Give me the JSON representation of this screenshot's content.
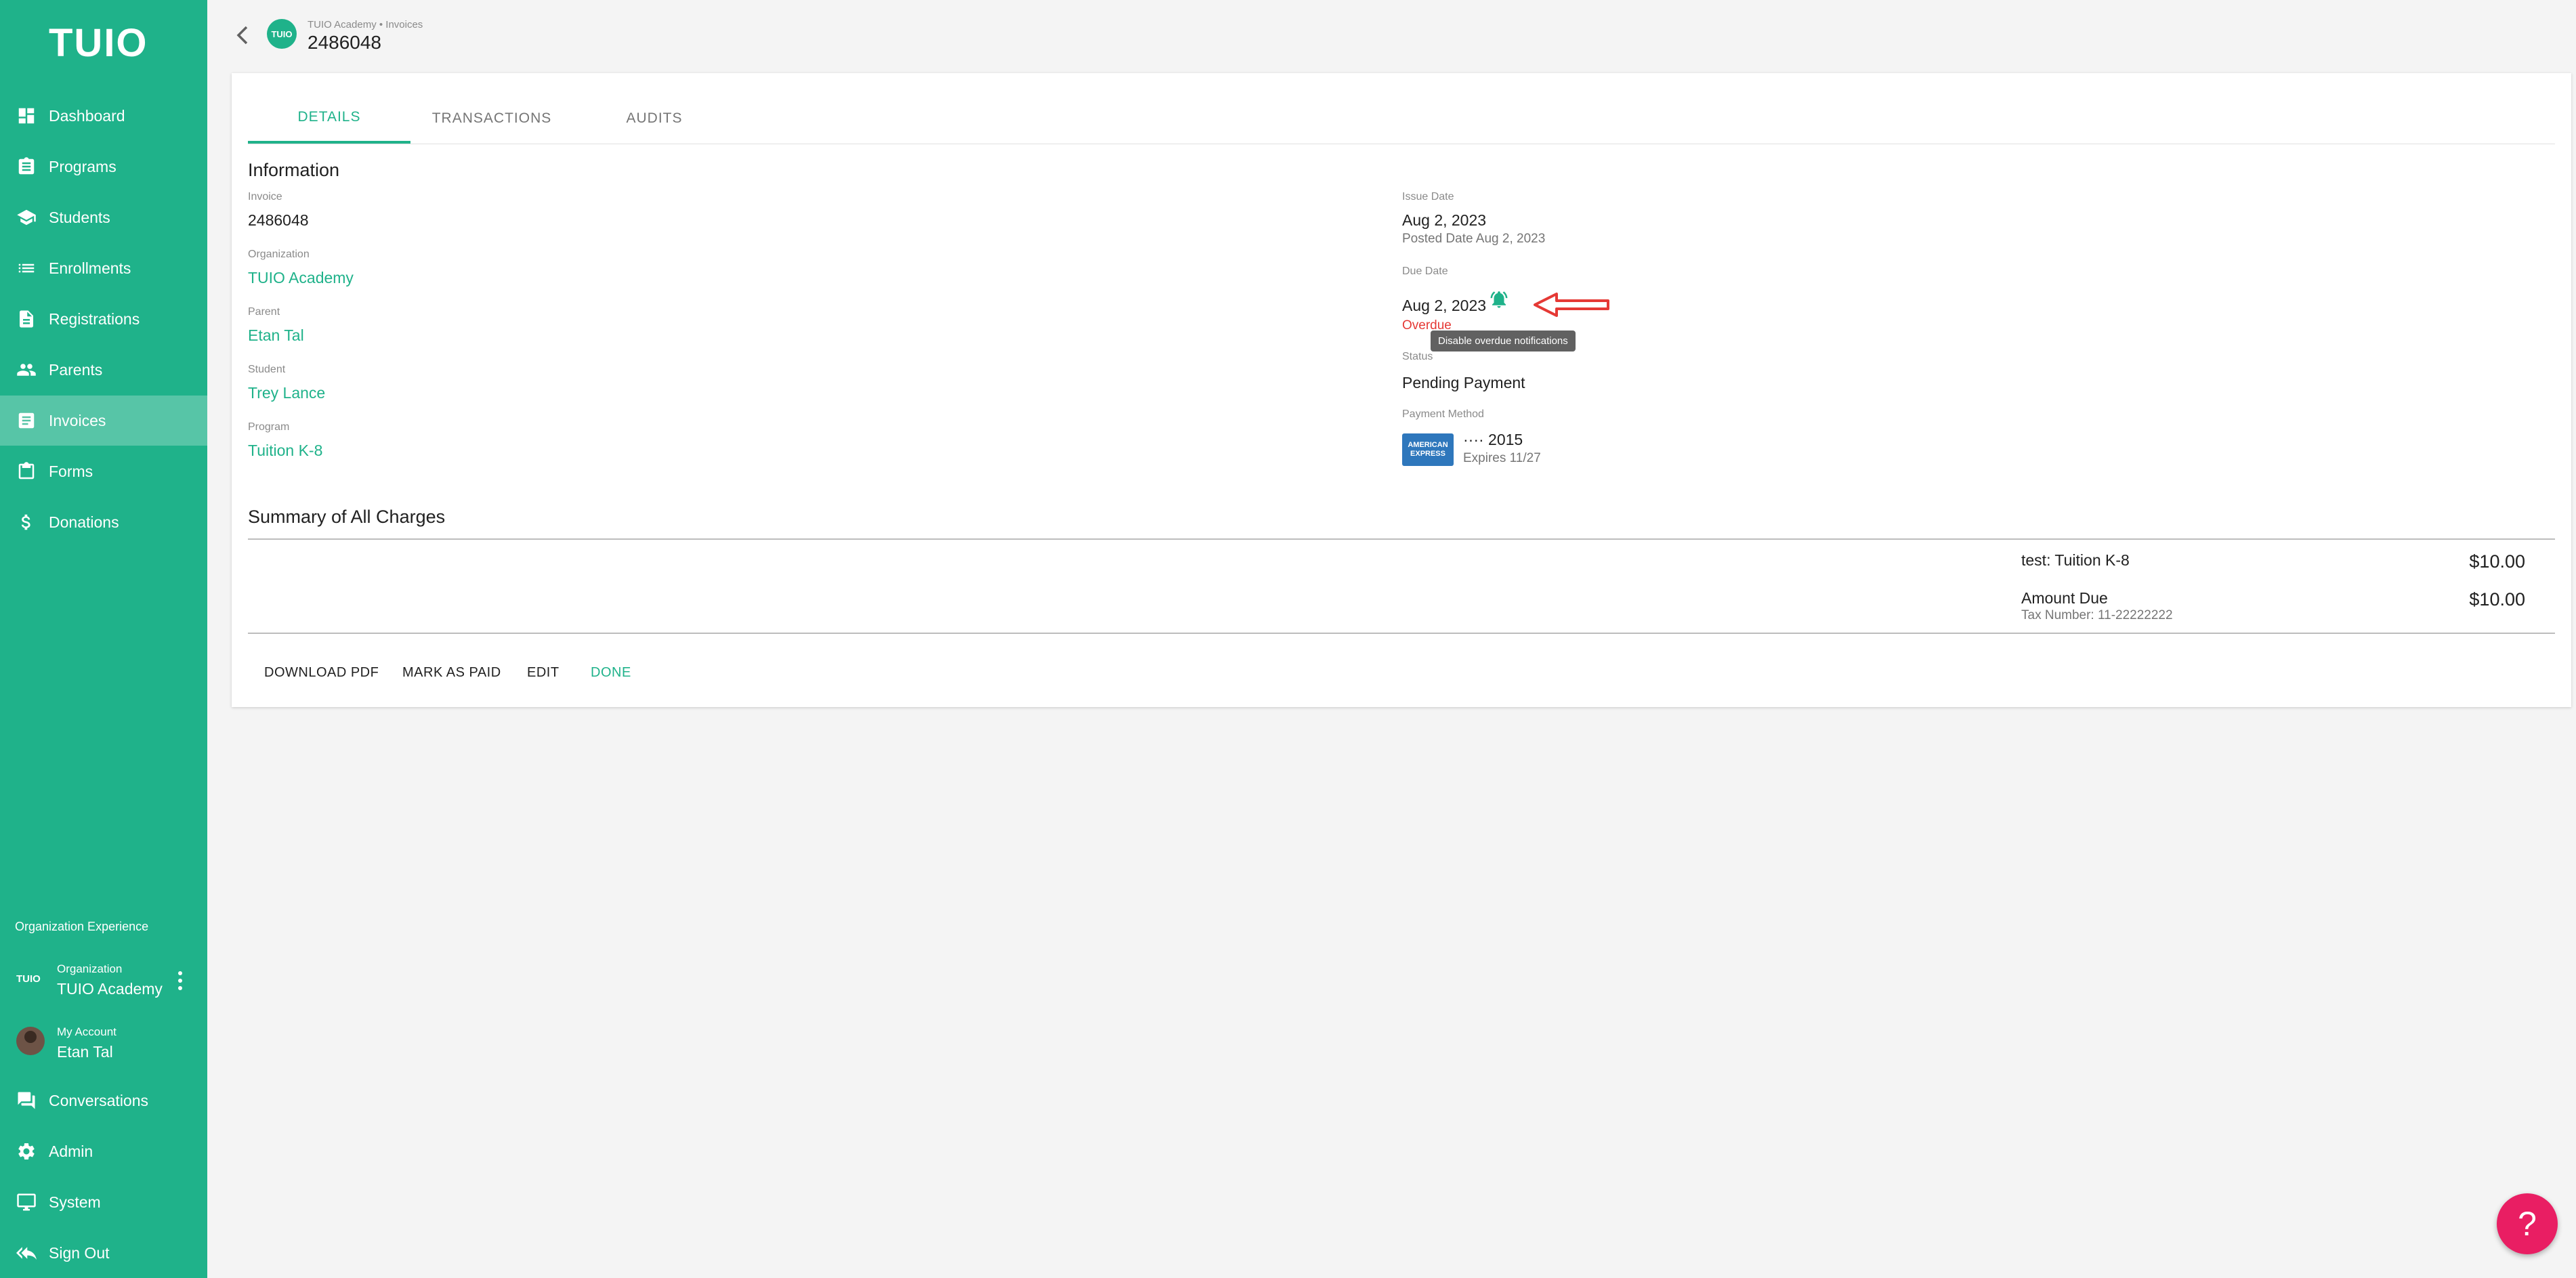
{
  "app": {
    "logo": "TUIO"
  },
  "sidebar": {
    "items": [
      {
        "label": "Dashboard",
        "icon": "dashboard-icon"
      },
      {
        "label": "Programs",
        "icon": "programs-icon"
      },
      {
        "label": "Students",
        "icon": "school-icon"
      },
      {
        "label": "Enrollments",
        "icon": "list-icon"
      },
      {
        "label": "Registrations",
        "icon": "document-icon"
      },
      {
        "label": "Parents",
        "icon": "people-icon"
      },
      {
        "label": "Invoices",
        "icon": "invoice-icon",
        "active": true
      },
      {
        "label": "Forms",
        "icon": "clipboard-icon"
      },
      {
        "label": "Donations",
        "icon": "dollar-icon"
      }
    ],
    "org_experience": "Organization Experience",
    "org": {
      "logo": "TUIO",
      "caption": "Organization",
      "name": "TUIO Academy"
    },
    "account": {
      "caption": "My Account",
      "name": "Etan Tal"
    },
    "bottom_items": [
      {
        "label": "Conversations",
        "icon": "chat-icon"
      },
      {
        "label": "Admin",
        "icon": "gear-icon"
      },
      {
        "label": "System",
        "icon": "monitor-icon"
      },
      {
        "label": "Sign Out",
        "icon": "reply-all-icon"
      }
    ]
  },
  "header": {
    "logo": "TUIO",
    "breadcrumb": "TUIO Academy • Invoices",
    "title": "2486048"
  },
  "tabs": [
    "DETAILS",
    "TRANSACTIONS",
    "AUDITS"
  ],
  "info": {
    "section_title": "Information",
    "invoice_label": "Invoice",
    "invoice_value": "2486048",
    "organization_label": "Organization",
    "organization_value": "TUIO Academy",
    "parent_label": "Parent",
    "parent_value": "Etan Tal",
    "student_label": "Student",
    "student_value": "Trey Lance",
    "program_label": "Program",
    "program_value": "Tuition K-8",
    "issue_date_label": "Issue Date",
    "issue_date_value": "Aug 2, 2023",
    "posted_date": "Posted Date Aug 2, 2023",
    "due_date_label": "Due Date",
    "due_date_value": "Aug 2, 2023",
    "overdue": "Overdue",
    "tooltip": "Disable overdue notifications",
    "status_label": "Status",
    "status_value": "Pending Payment",
    "payment_method_label": "Payment Method",
    "card_brand_line1": "AMERICAN",
    "card_brand_line2": "EXPRESS",
    "card_number": "···· 2015",
    "card_expires": "Expires 11/27"
  },
  "summary": {
    "title": "Summary of All Charges",
    "charge_name": "test: Tuition K-8",
    "charge_amount": "$10.00",
    "amount_due_label": "Amount Due",
    "tax_number": "Tax Number: 11-22222222",
    "amount_due_value": "$10.00"
  },
  "actions": {
    "download_pdf": "DOWNLOAD PDF",
    "mark_as_paid": "MARK AS PAID",
    "edit": "EDIT",
    "done": "DONE"
  },
  "fab": {
    "label": "?"
  },
  "colors": {
    "brand": "#1fb28a",
    "danger": "#e53935",
    "fab": "#e91e63"
  }
}
